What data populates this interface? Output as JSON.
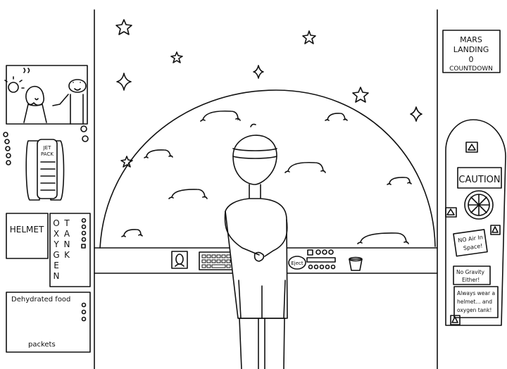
{
  "countdown_sign": {
    "line1": "MARS",
    "line2": "LANDING",
    "line3": "0",
    "line4": "COUNTDOWN"
  },
  "caution_sign": {
    "label": "CAUTION"
  },
  "notes": {
    "no_air": [
      "NO Air In",
      "Space!"
    ],
    "no_gravity": [
      "No Gravity",
      "Either!"
    ],
    "always_wear": [
      "Always wear a",
      "helmet... and",
      "oxygen tank!"
    ]
  },
  "jetpack": {
    "label_line1": "JET",
    "label_line2": "PACK"
  },
  "helmet": {
    "label": "HELMET"
  },
  "oxygen_tank": {
    "column1": [
      "O",
      "X",
      "Y",
      "G",
      "E",
      "N"
    ],
    "column2": [
      "T",
      "A",
      "N",
      "K"
    ]
  },
  "food": {
    "label": "Dehydrated food",
    "footer": "packets"
  },
  "console": {
    "eject_label": "Eject"
  }
}
